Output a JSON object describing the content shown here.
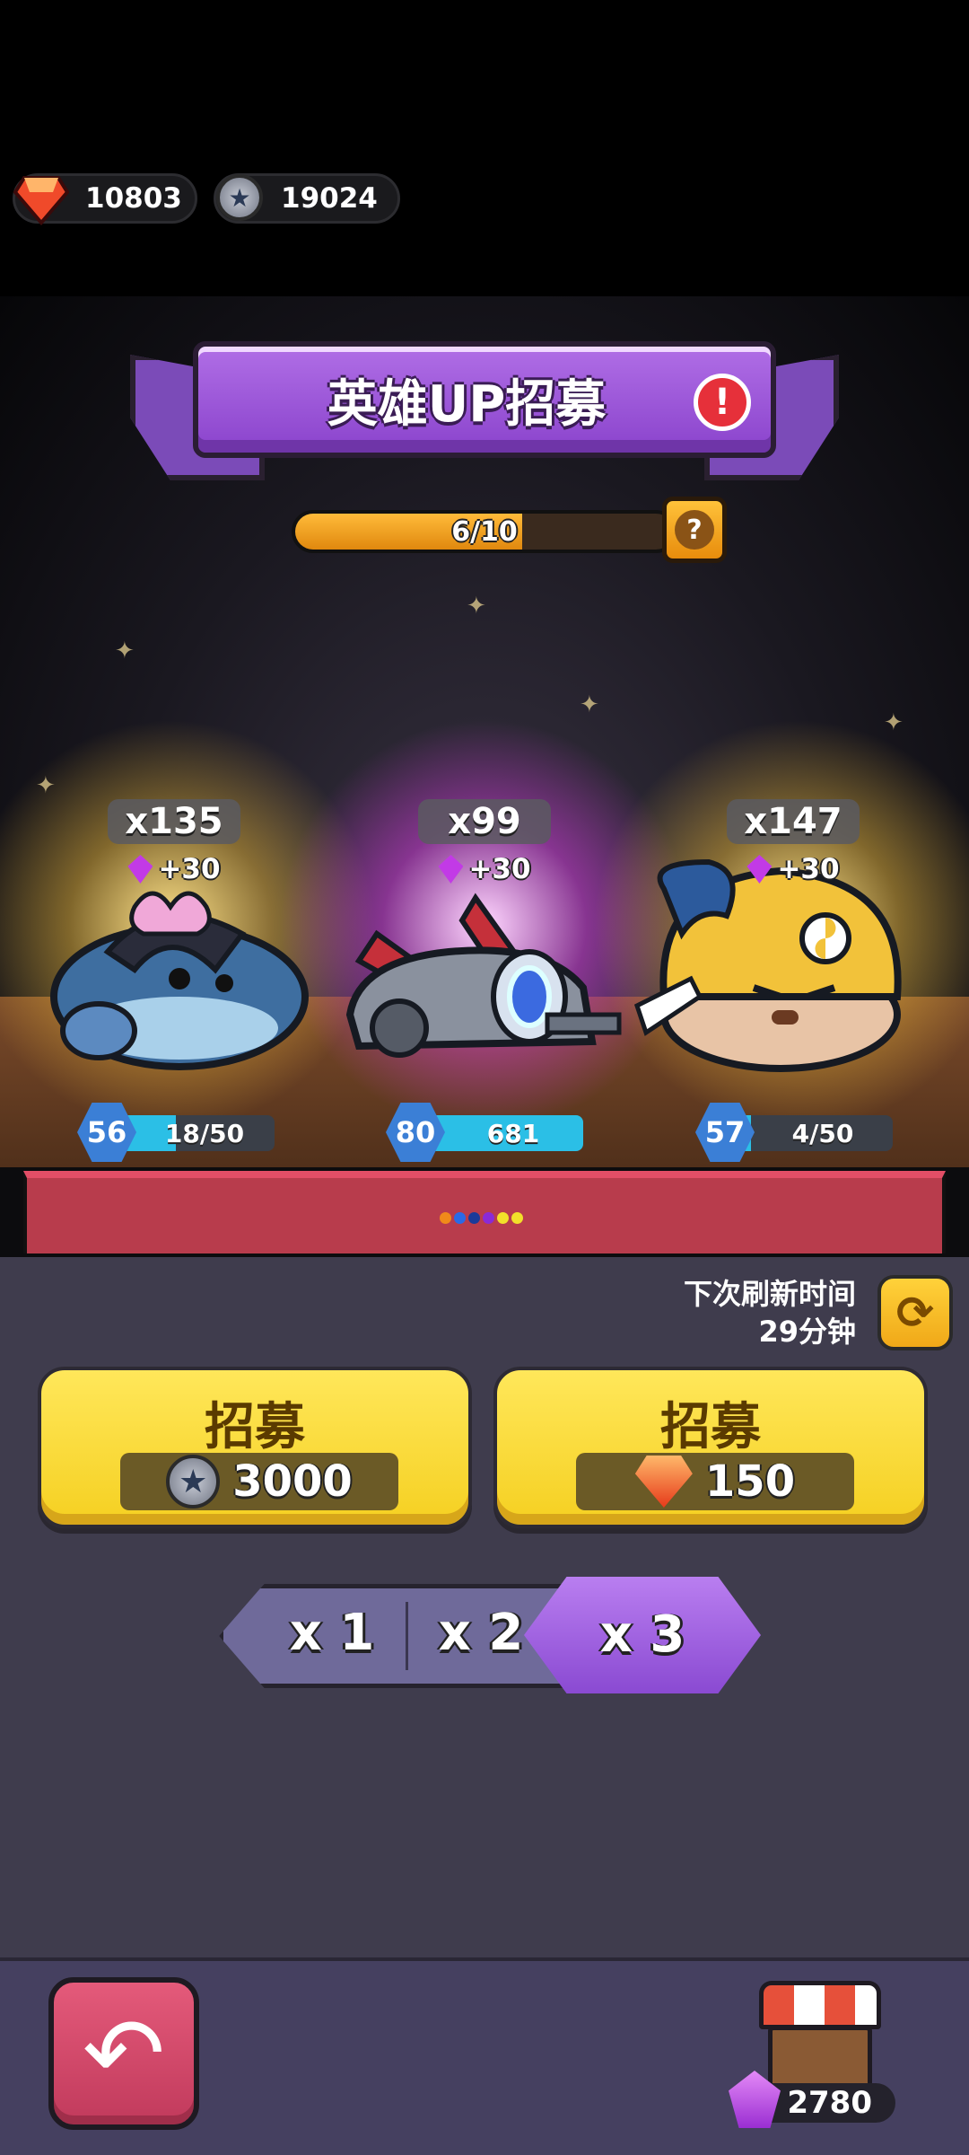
{
  "currency": {
    "gems": "10803",
    "coins": "19024"
  },
  "banner": {
    "title": "英雄UP招募",
    "alert": "!"
  },
  "progress": {
    "text": "6/10",
    "fraction": 0.6,
    "help": "?"
  },
  "heroes": [
    {
      "count": "x135",
      "bonus": "+30",
      "level": "56",
      "xp": "18/50",
      "xp_fraction": 0.36
    },
    {
      "count": "x99",
      "bonus": "+30",
      "level": "80",
      "xp": "681",
      "xp_fraction": 1.0
    },
    {
      "count": "x147",
      "bonus": "+30",
      "level": "57",
      "xp": "4/50",
      "xp_fraction": 0.08
    }
  ],
  "refresh": {
    "label_line1": "下次刷新时间",
    "label_line2": "29分钟"
  },
  "recruit": [
    {
      "title": "招募",
      "cost": "3000",
      "currency_icon": "silver-coin-icon"
    },
    {
      "title": "招募",
      "cost": "150",
      "currency_icon": "red-gem-icon"
    }
  ],
  "multiplier": {
    "options": [
      "x 1",
      "x 2",
      "x 3"
    ],
    "selected": "x 3"
  },
  "shop": {
    "gem_count": "2780"
  },
  "colors": {
    "accent_purple": "#8a43cc",
    "button_yellow": "#f5d021",
    "back_red": "#c13a5c",
    "panel": "#3f3c4d"
  }
}
